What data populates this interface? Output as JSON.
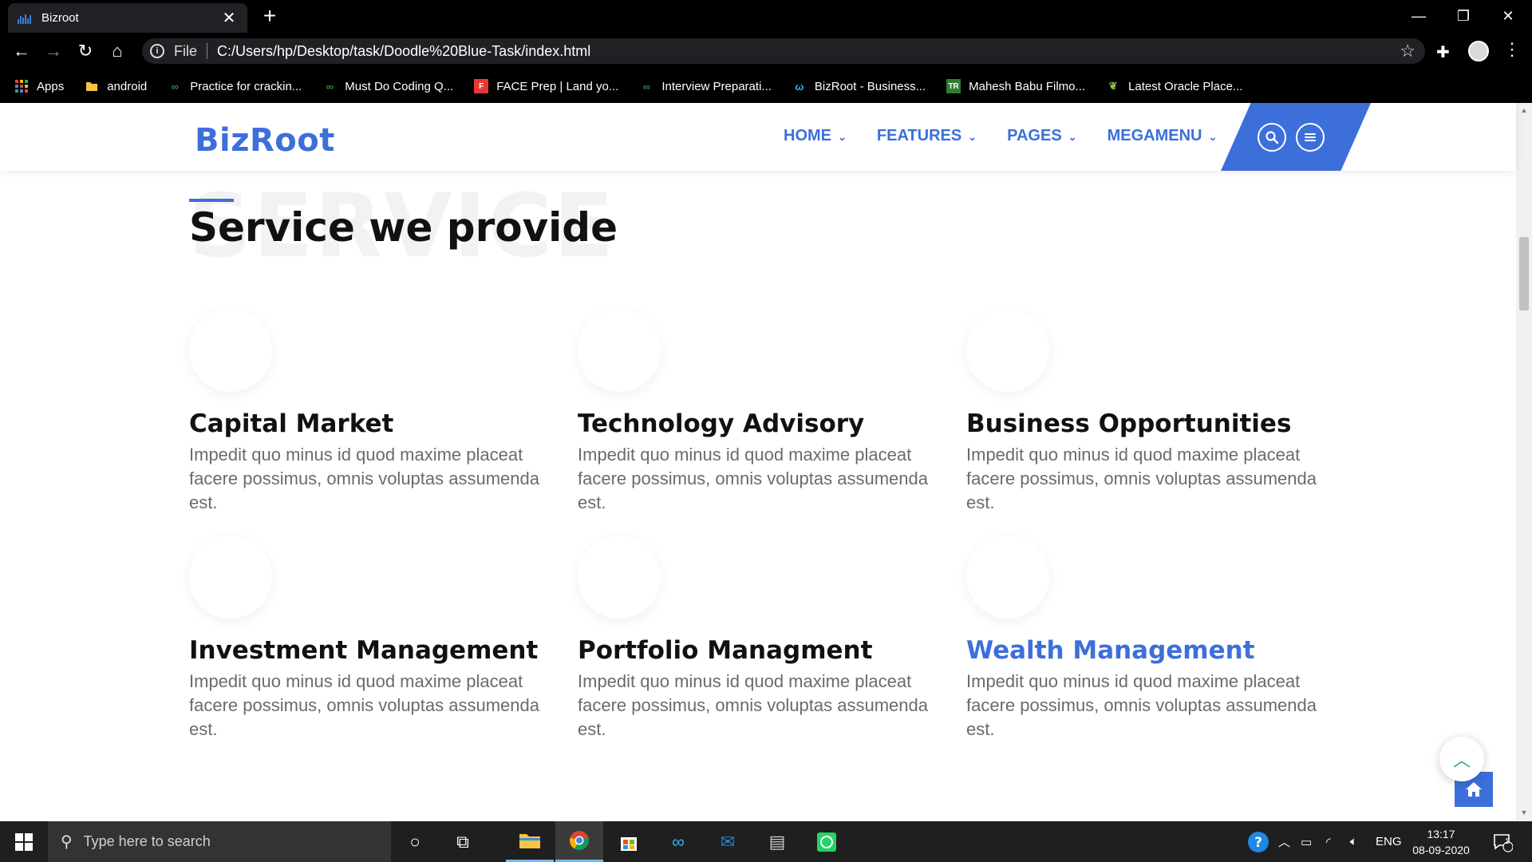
{
  "browser": {
    "tab_title": "Bizroot",
    "scheme": "File",
    "url": "C:/Users/hp/Desktop/task/Doodle%20Blue-Task/index.html",
    "bookmarks": [
      {
        "label": "Apps",
        "icon": "apps-grid-icon"
      },
      {
        "label": "android",
        "icon": "folder-icon"
      },
      {
        "label": "Practice for crackin...",
        "icon": "gfg-icon"
      },
      {
        "label": "Must Do Coding Q...",
        "icon": "gfg-icon"
      },
      {
        "label": "FACE Prep | Land yo...",
        "icon": "faceprep-icon"
      },
      {
        "label": "Interview Preparati...",
        "icon": "gfg-icon"
      },
      {
        "label": "BizRoot - Business...",
        "icon": "bizroot-icon"
      },
      {
        "label": "Mahesh Babu Filmo...",
        "icon": "tr-icon"
      },
      {
        "label": "Latest Oracle Place...",
        "icon": "leaf-icon"
      }
    ]
  },
  "site": {
    "logo": "BizRoot",
    "nav": [
      {
        "label": "HOME"
      },
      {
        "label": "FEATURES"
      },
      {
        "label": "PAGES"
      },
      {
        "label": "MEGAMENU"
      }
    ],
    "accent_color": "#3d6fdb"
  },
  "services": {
    "watermark": "SERVICE",
    "title": "Service we provide",
    "items": [
      {
        "title": "Capital Market",
        "desc": "Impedit quo minus id quod maxime placeat facere possimus, omnis voluptas assumenda est."
      },
      {
        "title": "Technology Advisory",
        "desc": "Impedit quo minus id quod maxime placeat facere possimus, omnis voluptas assumenda est."
      },
      {
        "title": "Business Opportunities",
        "desc": "Impedit quo minus id quod maxime placeat facere possimus, omnis voluptas assumenda est."
      },
      {
        "title": "Investment Management",
        "desc": "Impedit quo minus id quod maxime placeat facere possimus, omnis voluptas assumenda est."
      },
      {
        "title": "Portfolio Managment",
        "desc": "Impedit quo minus id quod maxime placeat facere possimus, omnis voluptas assumenda est."
      },
      {
        "title": "Wealth Management",
        "desc": "Impedit quo minus id quod maxime placeat facere possimus, omnis voluptas assumenda est."
      }
    ]
  },
  "taskbar": {
    "search_placeholder": "Type here to search",
    "language": "ENG",
    "time": "13:17",
    "date": "08-09-2020",
    "notification_count": "1"
  }
}
